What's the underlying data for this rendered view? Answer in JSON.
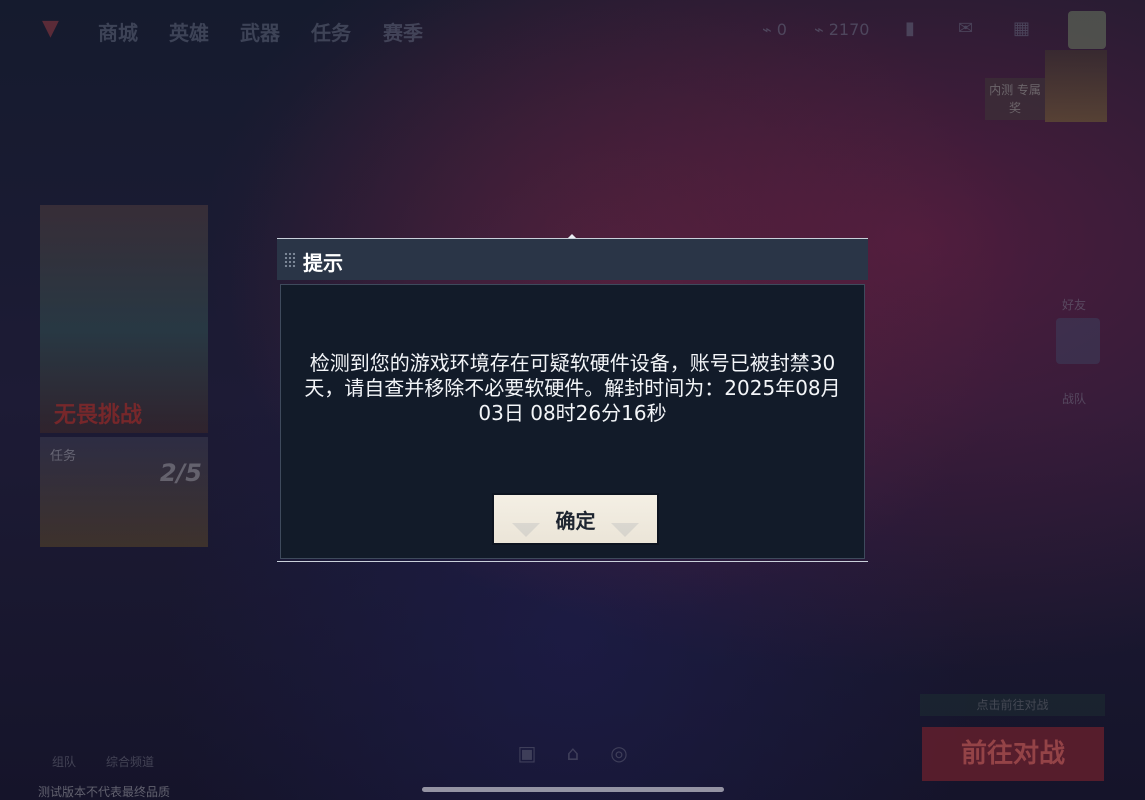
{
  "nav": {
    "items": [
      "商城",
      "英雄",
      "武器",
      "任务",
      "赛季"
    ],
    "currency_a": "0",
    "currency_b": "2170"
  },
  "portrait": {
    "tag": "内测 专属奖"
  },
  "left_cards": {
    "event_title": "无畏挑战",
    "task_label": "任务",
    "task_count": "2/5"
  },
  "right_side": {
    "label_a": "好友",
    "label_b": "战队",
    "battle_hint": "点击前往对战",
    "battle_button": "前往对战"
  },
  "bottom": {
    "chat_label": "组队",
    "channel_label": "综合频道",
    "footer": "测试版本不代表最终品质"
  },
  "dialog": {
    "title": "提示",
    "message": "检测到您的游戏环境存在可疑软硬件设备，账号已被封禁30天，请自查并移除不必要软硬件。解封时间为：2025年08月03日 08时26分16秒",
    "confirm_label": "确定"
  }
}
